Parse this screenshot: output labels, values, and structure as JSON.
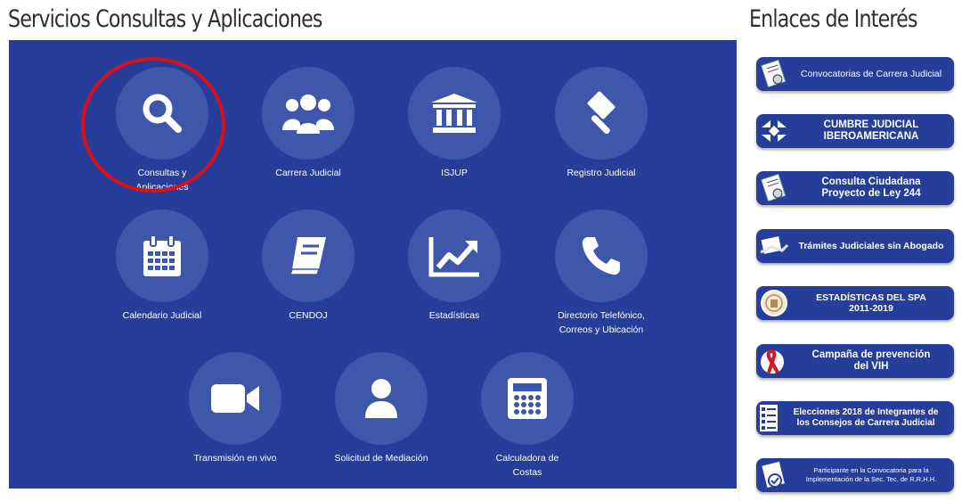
{
  "main": {
    "title": "Servicios Consultas y Aplicaciones",
    "tiles": [
      {
        "label": [
          "Consultas y",
          "Aplicaciones"
        ],
        "icon": "search-icon"
      },
      {
        "label": [
          "Carrera Judicial"
        ],
        "icon": "users-icon"
      },
      {
        "label": [
          "ISJUP"
        ],
        "icon": "institution-icon"
      },
      {
        "label": [
          "Registro Judicial"
        ],
        "icon": "gavel-icon"
      },
      {
        "label": [
          "Calendario Judicial"
        ],
        "icon": "calendar-icon"
      },
      {
        "label": [
          "CENDOJ"
        ],
        "icon": "book-icon"
      },
      {
        "label": [
          "Estadísticas"
        ],
        "icon": "line-chart-icon"
      },
      {
        "label": [
          "Directorio Telefónico,",
          "Correos y Ubicación"
        ],
        "icon": "phone-icon"
      },
      {
        "label": [
          "Transmisión en vivo"
        ],
        "icon": "video-camera-icon"
      },
      {
        "label": [
          "Solicitud de Mediación"
        ],
        "icon": "user-icon"
      },
      {
        "label": [
          "Calculadora de",
          "Costas"
        ],
        "icon": "calculator-icon"
      }
    ]
  },
  "sidebar": {
    "title": "Enlaces de Interés",
    "links": [
      {
        "lines": [
          "Convocatorias de Carrera Judicial"
        ],
        "icon": "document-seal-icon",
        "style": "normal-weight"
      },
      {
        "lines": [
          "CUMBRE JUDICIAL",
          "IBEROAMERICANA"
        ],
        "icon": "cumbre-logo-icon",
        "style": "big"
      },
      {
        "lines": [
          "Consulta Ciudadana",
          "Proyecto de Ley 244"
        ],
        "icon": "document-seal-icon",
        "style": "big"
      },
      {
        "lines": [
          "Trámites Judiciales sin Abogado"
        ],
        "icon": "handshake-icon",
        "style": "bold"
      },
      {
        "lines": [
          "ESTADÍSTICAS DEL SPA",
          "2011-2019"
        ],
        "icon": "seal-icon",
        "style": "bold"
      },
      {
        "lines": [
          "Campaña de prevención",
          "del VIH"
        ],
        "icon": "red-ribbon-icon",
        "style": "big"
      },
      {
        "lines": [
          "Elecciones 2018 de Integrantes de",
          "los Consejos de Carrera Judicial"
        ],
        "icon": "ballot-list-icon",
        "style": "bold"
      },
      {
        "lines": [
          "Participante en la Convocatoria para la",
          "Implementación de la Sec. Tec. de R.R.H.H."
        ],
        "icon": "certificate-check-icon",
        "style": "small"
      }
    ]
  },
  "colors": {
    "panel": "#263e9a",
    "circle": "#3e57ab",
    "highlight": "#d8101b"
  }
}
